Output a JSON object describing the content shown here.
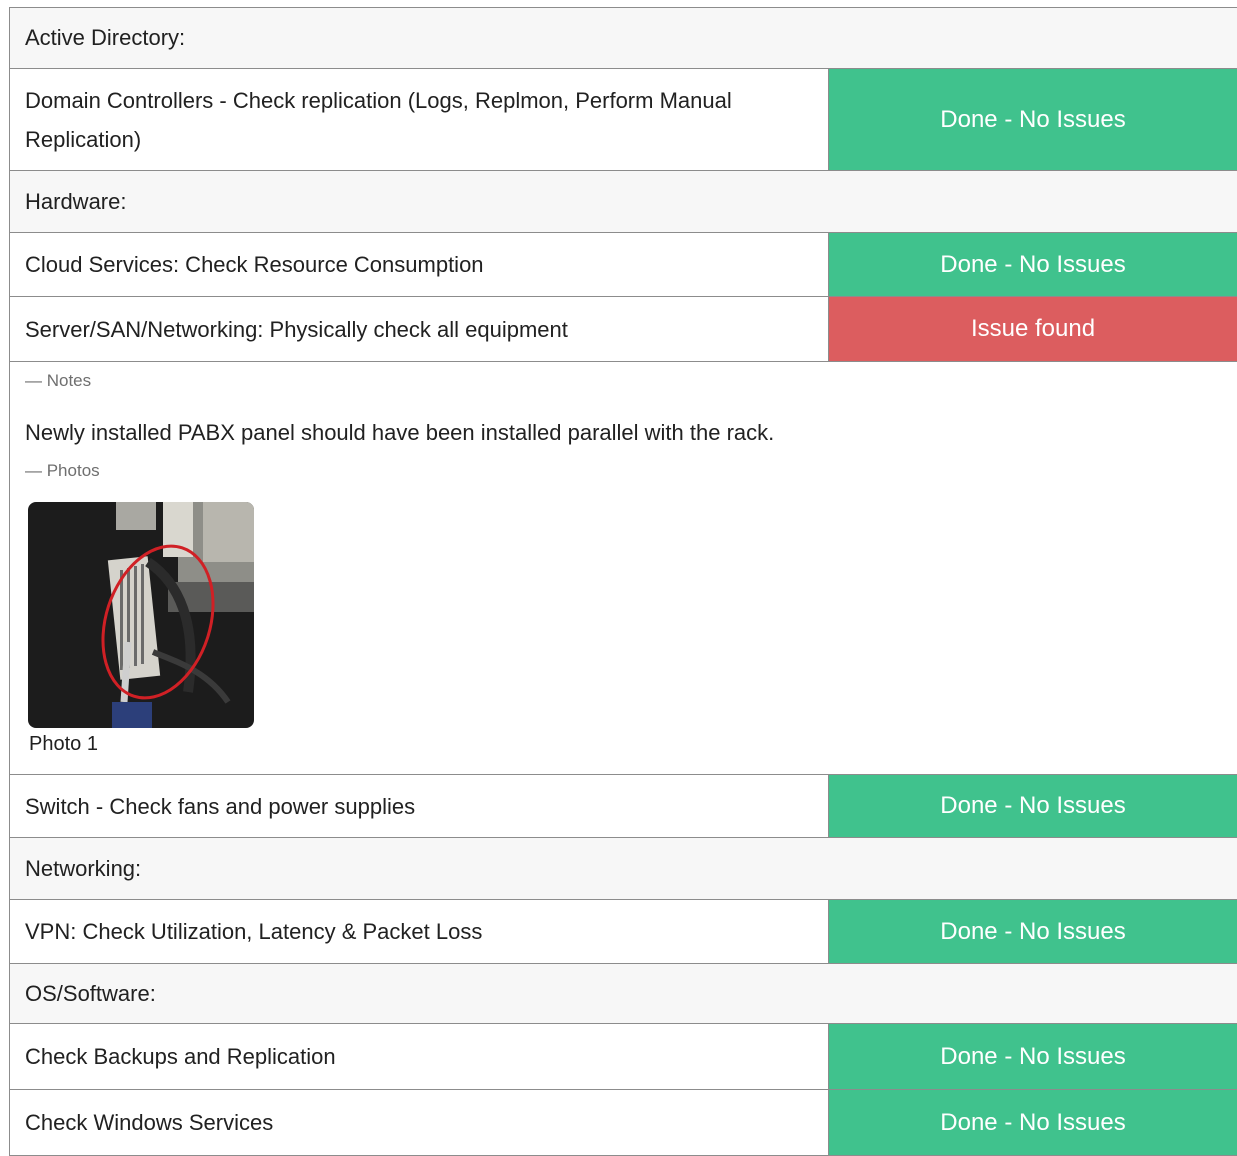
{
  "sections": {
    "active_directory": "Active Directory:",
    "hardware": "Hardware:",
    "networking": "Networking:",
    "os_software": "OS/Software:"
  },
  "items": {
    "dc_replication": {
      "label": "Domain Controllers - Check replication (Logs, Replmon, Perform Manual Replication)",
      "status": "Done - No Issues"
    },
    "cloud_services": {
      "label": "Cloud Services: Check Resource Consumption",
      "status": "Done - No Issues"
    },
    "server_san": {
      "label": "Server/SAN/Networking: Physically check all equipment",
      "status": "Issue found"
    },
    "switch": {
      "label": "Switch - Check fans and power supplies",
      "status": "Done - No Issues"
    },
    "vpn": {
      "label": "VPN: Check Utilization, Latency & Packet Loss",
      "status": "Done - No Issues"
    },
    "backups": {
      "label": "Check Backups and Replication",
      "status": "Done - No Issues"
    },
    "windows_services": {
      "label": "Check Windows Services",
      "status": "Done - No Issues"
    }
  },
  "details": {
    "notes_heading": "— Notes",
    "notes_text": "Newly installed PABX panel should have been installed parallel with the rack.",
    "photos_heading": "— Photos",
    "photo_caption": "Photo 1"
  },
  "colors": {
    "done": "#40c28d",
    "issue": "#dc5d5f",
    "section_bg": "#f7f7f7",
    "border": "#8c8c8c"
  }
}
